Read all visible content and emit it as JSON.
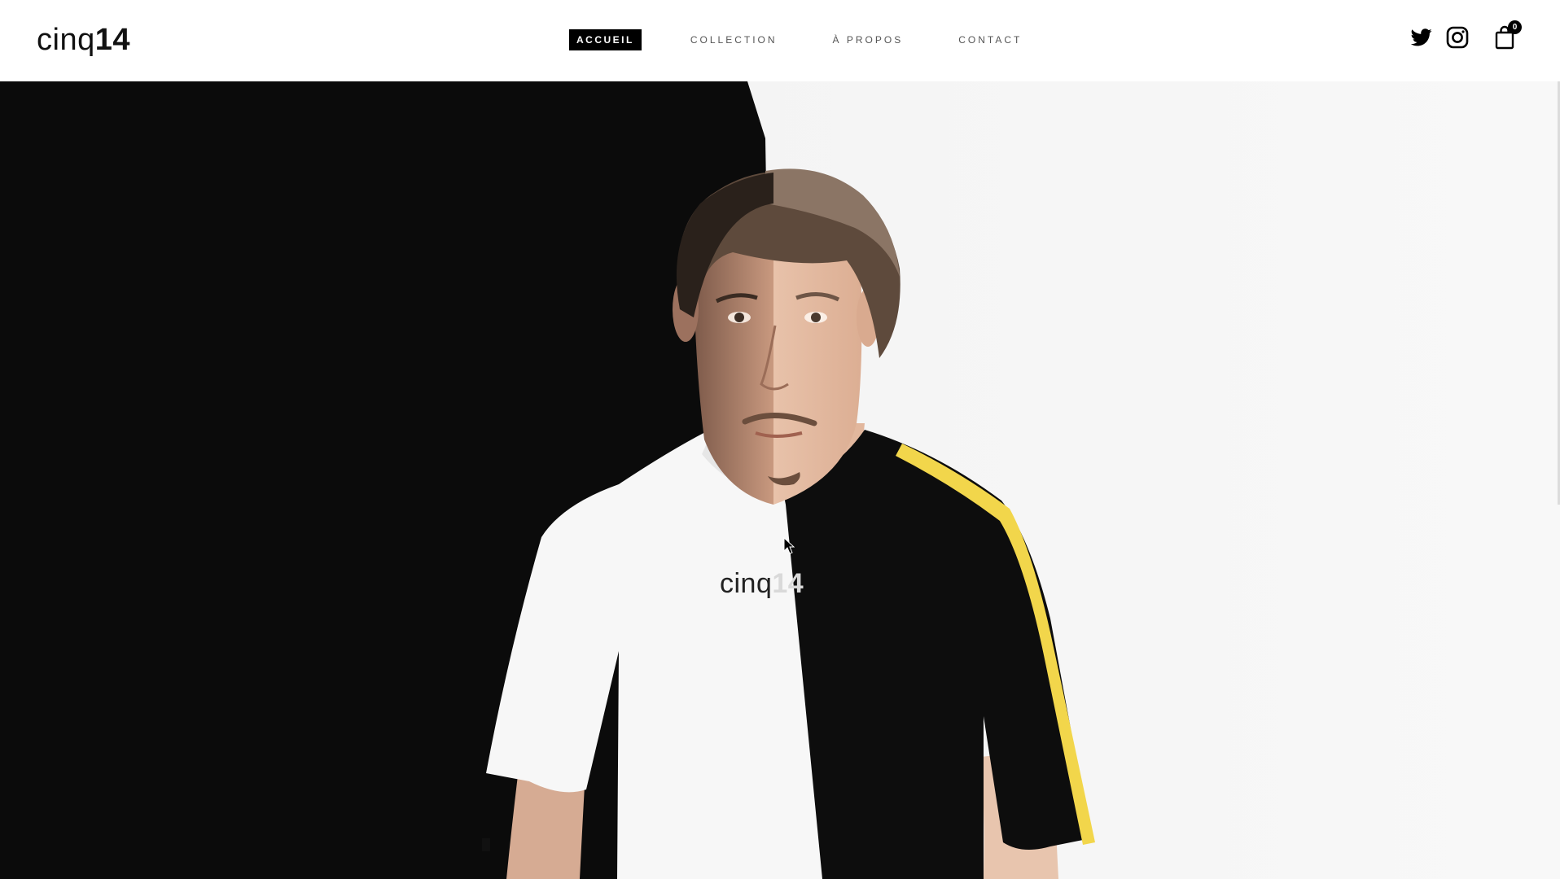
{
  "brand": {
    "logo_light": "cinq",
    "logo_bold": "14"
  },
  "nav": {
    "items": [
      {
        "label": "ACCUEIL",
        "active": true
      },
      {
        "label": "COLLECTION",
        "active": false
      },
      {
        "label": "À PROPOS",
        "active": false
      },
      {
        "label": "CONTACT",
        "active": false
      }
    ]
  },
  "header_icons": {
    "twitter": "twitter-icon",
    "instagram": "instagram-icon",
    "cart": "shopping-bag-icon",
    "cart_count": "0"
  },
  "hero": {
    "shirt_text_light": "cinq",
    "shirt_text_bold": "14",
    "colors": {
      "left_background": "#0b0b0b",
      "right_background": "#f4f4f4",
      "shirt_white": "#f7f7f7",
      "shirt_black": "#0d0d0d",
      "stripe_yellow": "#f2d64b"
    }
  }
}
